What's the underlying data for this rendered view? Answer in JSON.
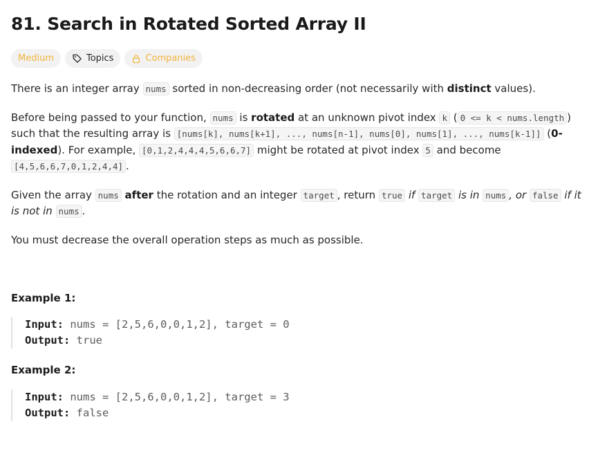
{
  "problem": {
    "title": "81. Search in Rotated Sorted Array II"
  },
  "tags": {
    "difficulty": "Medium",
    "topics": "Topics",
    "companies": "Companies"
  },
  "icons": {
    "tag": "tag-icon",
    "lock": "lock-icon"
  },
  "colors": {
    "difficulty_medium": "#f0b43a",
    "text": "#262626",
    "tag_bg": "#f2f2f2"
  },
  "description": {
    "p1": {
      "t1": "There is an integer array ",
      "c1": "nums",
      "t2": " sorted in non-decreasing order (not necessarily with ",
      "b1": "distinct",
      "t3": " values)."
    },
    "p2": {
      "t1": "Before being passed to your function, ",
      "c1": "nums",
      "t2": " is ",
      "b1": "rotated",
      "t3": " at an unknown pivot index ",
      "c2": "k",
      "t4": " (",
      "c3": "0 <= k < nums.length",
      "t5": ") such that the resulting array is ",
      "c4": "[nums[k], nums[k+1], ..., nums[n-1], nums[0], nums[1], ..., nums[k-1]]",
      "t6": " (",
      "b2": "0-indexed",
      "t7": "). For example, ",
      "c5": "[0,1,2,4,4,4,5,6,6,7]",
      "t8": " might be rotated at pivot index ",
      "c6": "5",
      "t9": " and become ",
      "c7": "[4,5,6,6,7,0,1,2,4,4]",
      "t10": "."
    },
    "p3": {
      "t1": "Given the array ",
      "c1": "nums",
      "t2": " ",
      "b1": "after",
      "t3": " the rotation and an integer ",
      "c2": "target",
      "t4": ", return ",
      "c3": "true",
      "t5": " ",
      "e1": "if ",
      "c4": "target",
      "e2": " is in ",
      "c5": "nums",
      "e3": ", or ",
      "c6": "false",
      "e4": " if it is not in ",
      "c7": "nums",
      "t6": "."
    },
    "p4": "You must decrease the overall operation steps as much as possible."
  },
  "examples": [
    {
      "title": "Example 1:",
      "input_label": "Input:",
      "input_value": "nums = [2,5,6,0,0,1,2], target = 0",
      "output_label": "Output:",
      "output_value": "true"
    },
    {
      "title": "Example 2:",
      "input_label": "Input:",
      "input_value": "nums = [2,5,6,0,0,1,2], target = 3",
      "output_label": "Output:",
      "output_value": "false"
    }
  ]
}
